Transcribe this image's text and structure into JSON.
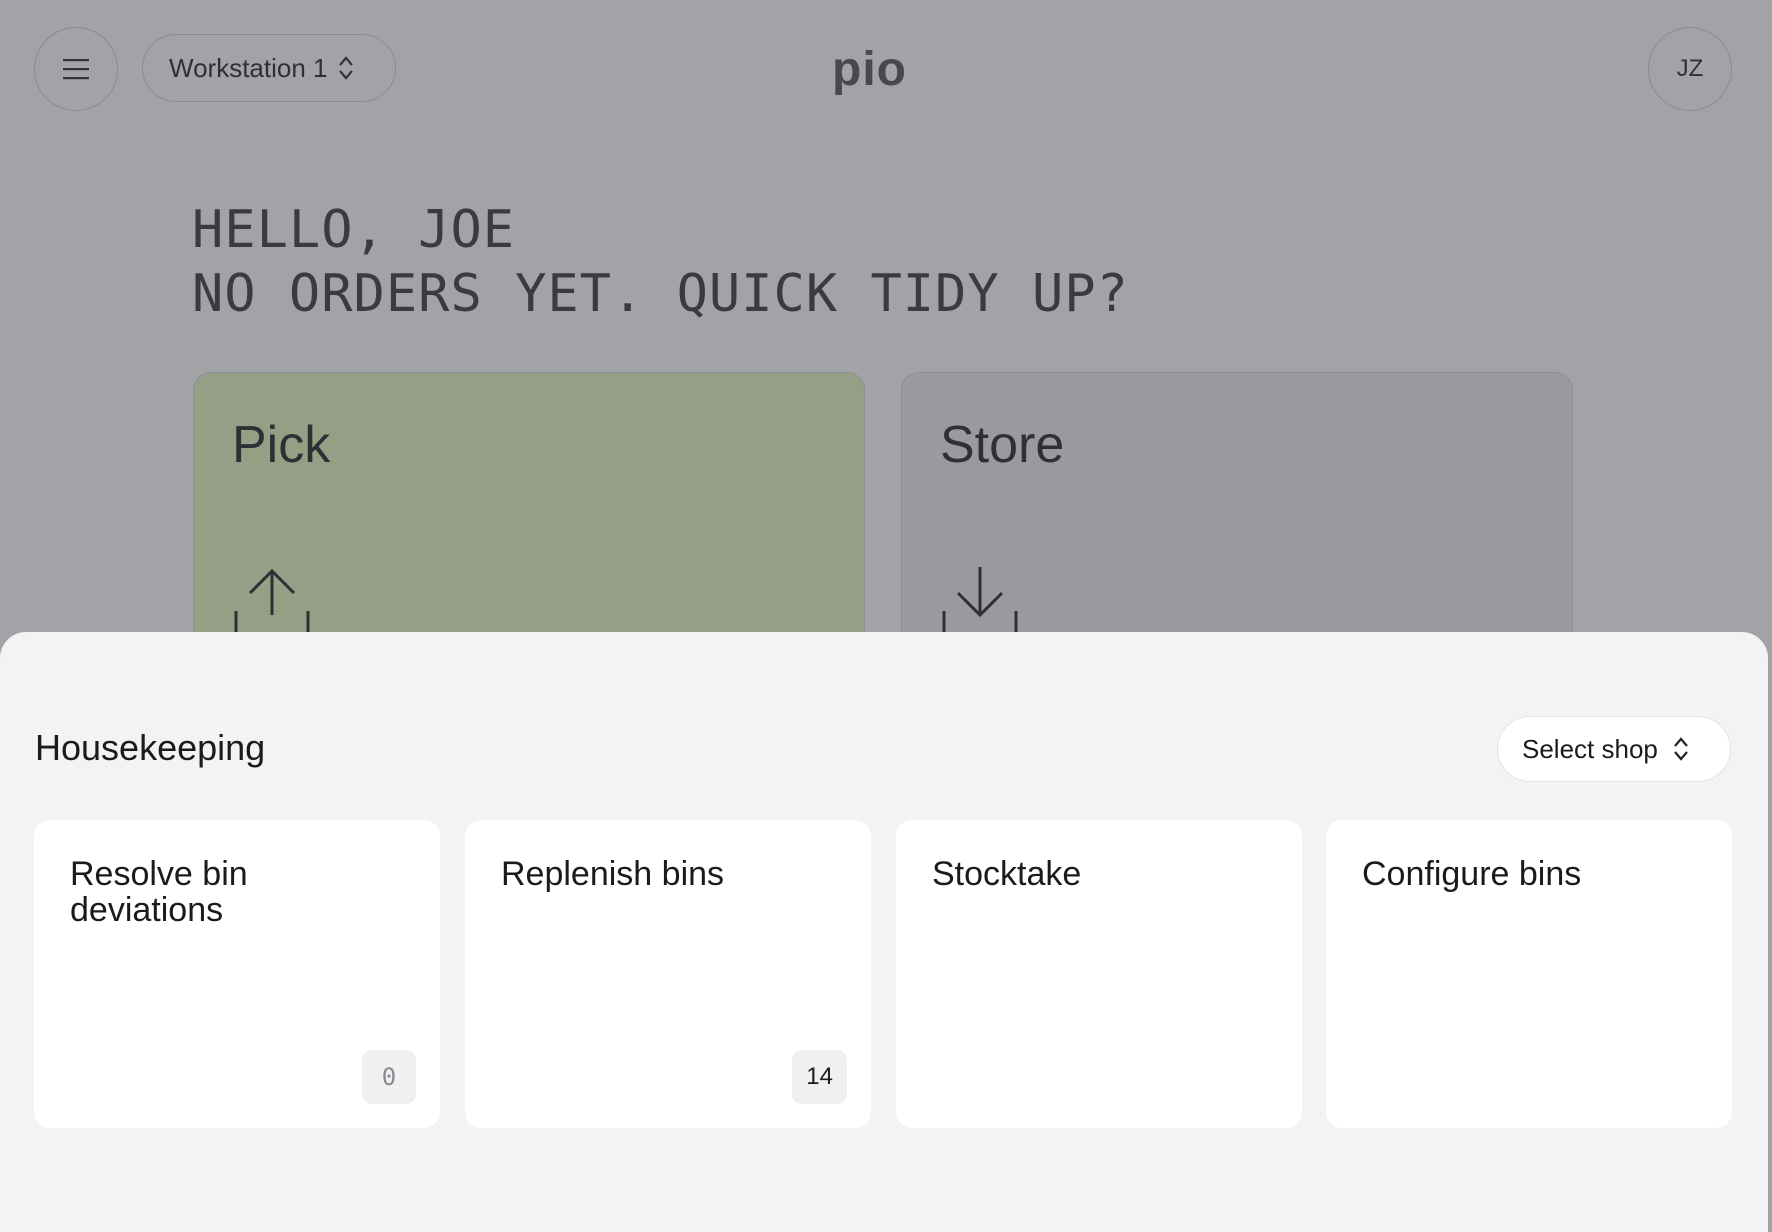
{
  "header": {
    "workstation_label": "Workstation 1",
    "logo_text": "pio",
    "avatar_initials": "JZ"
  },
  "greeting": {
    "line1": "HELLO, JOE",
    "line2": "NO ORDERS YET. QUICK TIDY UP?"
  },
  "tiles": {
    "pick": {
      "label": "Pick"
    },
    "store": {
      "label": "Store"
    }
  },
  "housekeeping": {
    "title": "Housekeeping",
    "shop_select_label": "Select shop",
    "cards": [
      {
        "label": "Resolve bin deviations",
        "count": "0"
      },
      {
        "label": "Replenish bins",
        "count": "14"
      },
      {
        "label": "Stocktake"
      },
      {
        "label": "Configure bins"
      }
    ]
  },
  "colors": {
    "pick_tile": "#e1edb9",
    "store_tile": "#e6e7ea",
    "sheet_bg": "#f2f3f5",
    "scrim": "rgba(70,72,78,0.48)"
  },
  "icons": {
    "menu": "hamburger-icon",
    "workstation_chevron": "chevron-up-down-icon",
    "pick": "upload-tray-icon",
    "store": "download-tray-icon",
    "shop_chevron": "chevron-up-down-icon"
  }
}
